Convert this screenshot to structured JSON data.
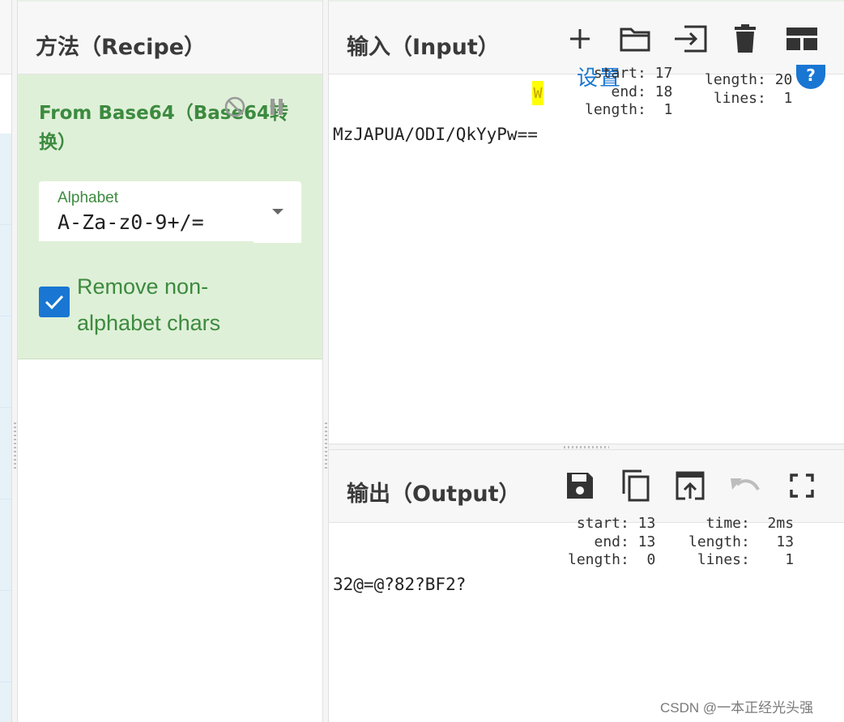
{
  "recipe": {
    "title": "方法（Recipe）",
    "operation": {
      "title": "From Base64（Base64转换）",
      "alphabet_label": "Alphabet",
      "alphabet_value": "A-Za-z0-9+/=",
      "remove_label": "Remove non-alphabet chars",
      "remove_checked": true
    }
  },
  "input": {
    "title": "输入（Input）",
    "overlay_text": "设置",
    "highlight_char": "W",
    "stats_left": "start: 17\n  end: 18\nlength:  1",
    "stats_right": "length: 20\n lines:  1",
    "text": "MzJAPUA/ODI/QkYyPw=="
  },
  "output": {
    "title": "输出（Output）",
    "stats_left": "start: 13\n  end: 13\nlength:  0",
    "stats_right": "  time:  2ms\nlength:   13\n lines:    1",
    "text": "32@=@?82?BF2?"
  },
  "watermark": "CSDN @一本正经光头强",
  "colors": {
    "accent": "#1976d2",
    "recipe_green": "#3c8a3f",
    "op_bg": "#dff0d8"
  }
}
